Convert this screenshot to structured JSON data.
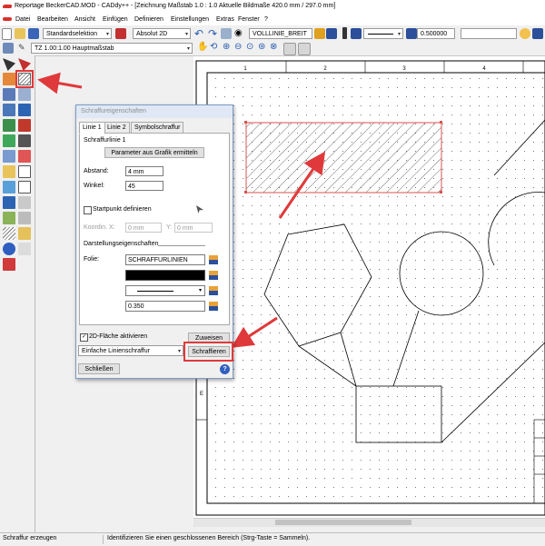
{
  "window": {
    "title": "Reportage BeckerCAD.MOD  -  CADdy++ - [Zeichnung    Maßstab 1.0 : 1.0   Aktuelle Bildmaße 420.0 mm / 297.0 mm]"
  },
  "menu": [
    "Datei",
    "Bearbeiten",
    "Ansicht",
    "Einfügen",
    "Definieren",
    "Einstellungen",
    "Extras",
    "Fenster",
    "?"
  ],
  "toolbar": {
    "selection_mode": "Standardselektion",
    "coord_mode": "Absolut 2D",
    "linetype": "VOLLLINIE_BREIT",
    "line_width": "0.500000",
    "scale_combo": "TZ 1.00:1.00 Hauptmaßstab"
  },
  "ruler": {
    "top_numbers": [
      "1",
      "2",
      "3",
      "4"
    ],
    "left_letters": [
      "E"
    ]
  },
  "dialog": {
    "title": "Schraffureigenschaften",
    "tabs": [
      "Linie 1",
      "Linie 2",
      "Symbolschraffur"
    ],
    "section_title": "Schraffurlinie 1",
    "btn_from_graphic": "Parameter aus Grafik ermitteln",
    "abstand_label": "Abstand:",
    "abstand_value": "4 mm",
    "winkel_label": "Winkel:",
    "winkel_value": "45",
    "startpunkt_label": "Startpunkt definieren",
    "coord_x_label": "Koordin. X:",
    "coord_x_value": "0 mm",
    "coord_y_label": "Y:",
    "coord_y_value": "0 mm",
    "display_props_label": "Darstellungseigenschaften",
    "folie_label": "Folie:",
    "folie_value": "SCHRAFFURLINIEN",
    "pen_width": "0.350",
    "flaeche_label": "2D-Fläche aktivieren",
    "btn_zuweisen": "Zuweisen",
    "hatch_type": "Einfache Linienschraffur",
    "btn_schraffieren": "Schraffieren",
    "btn_schliessen": "Schließen",
    "help": "?"
  },
  "status": {
    "left": "Schraffur erzeugen",
    "message": "Identifizieren Sie einen geschlossenen Bereich (Strg-Taste = Sammeln)."
  },
  "colors": {
    "accent_red": "#e0393b",
    "hatch_rect": "#d9534f"
  }
}
